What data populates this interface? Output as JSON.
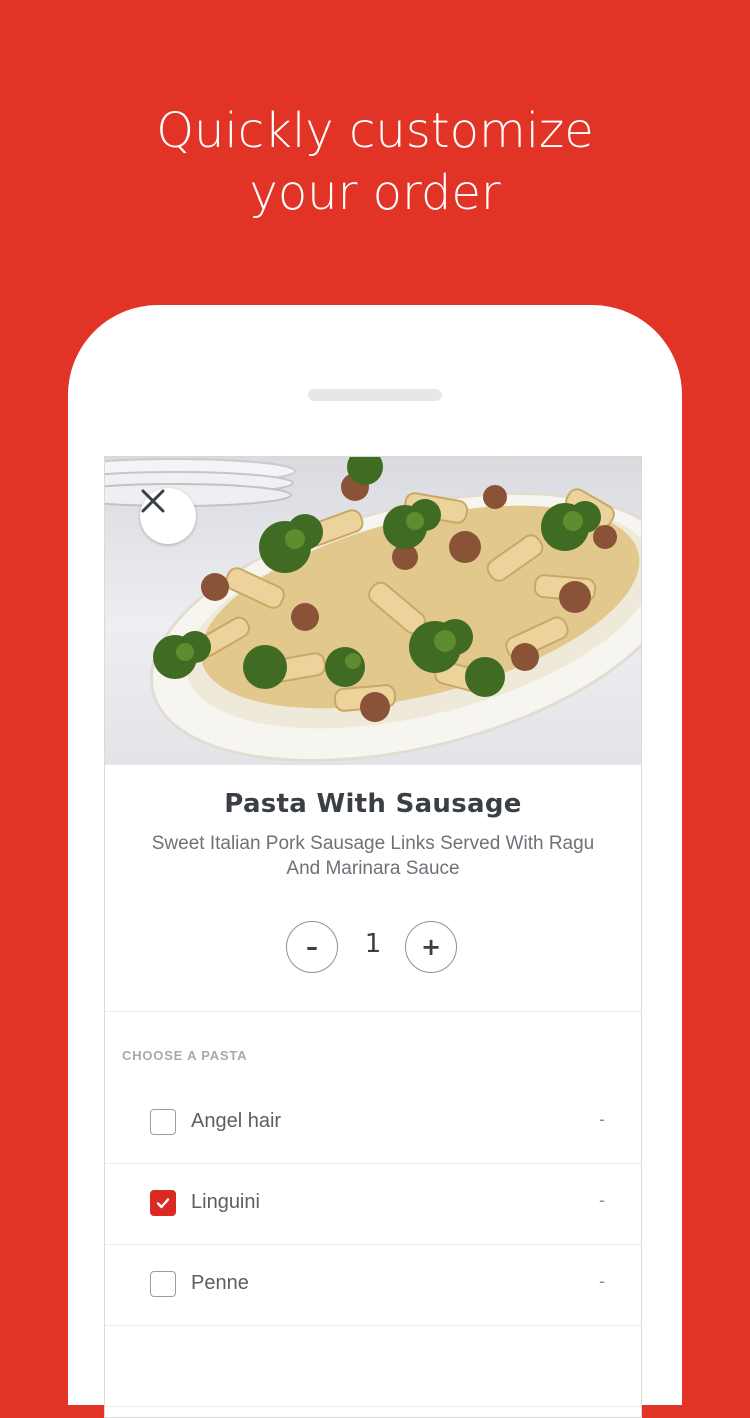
{
  "headline": {
    "line1": "Quickly customize",
    "line2": "your order"
  },
  "item": {
    "title": "Pasta With Sausage",
    "description": "Sweet Italian Pork Sausage Links Served With Ragu And Marinara Sauce"
  },
  "quantity": {
    "minus": "–",
    "value": "1",
    "plus": "+"
  },
  "options": {
    "section_label": "CHOOSE A PASTA",
    "items": [
      {
        "label": "Angel hair",
        "price": "-",
        "checked": false
      },
      {
        "label": "Linguini",
        "price": "-",
        "checked": true
      },
      {
        "label": "Penne",
        "price": "-",
        "checked": false
      }
    ]
  },
  "colors": {
    "brand_red": "#e23327",
    "checkbox_red": "#d92b24"
  },
  "icons": {
    "close": "close-icon",
    "check": "check-icon"
  }
}
